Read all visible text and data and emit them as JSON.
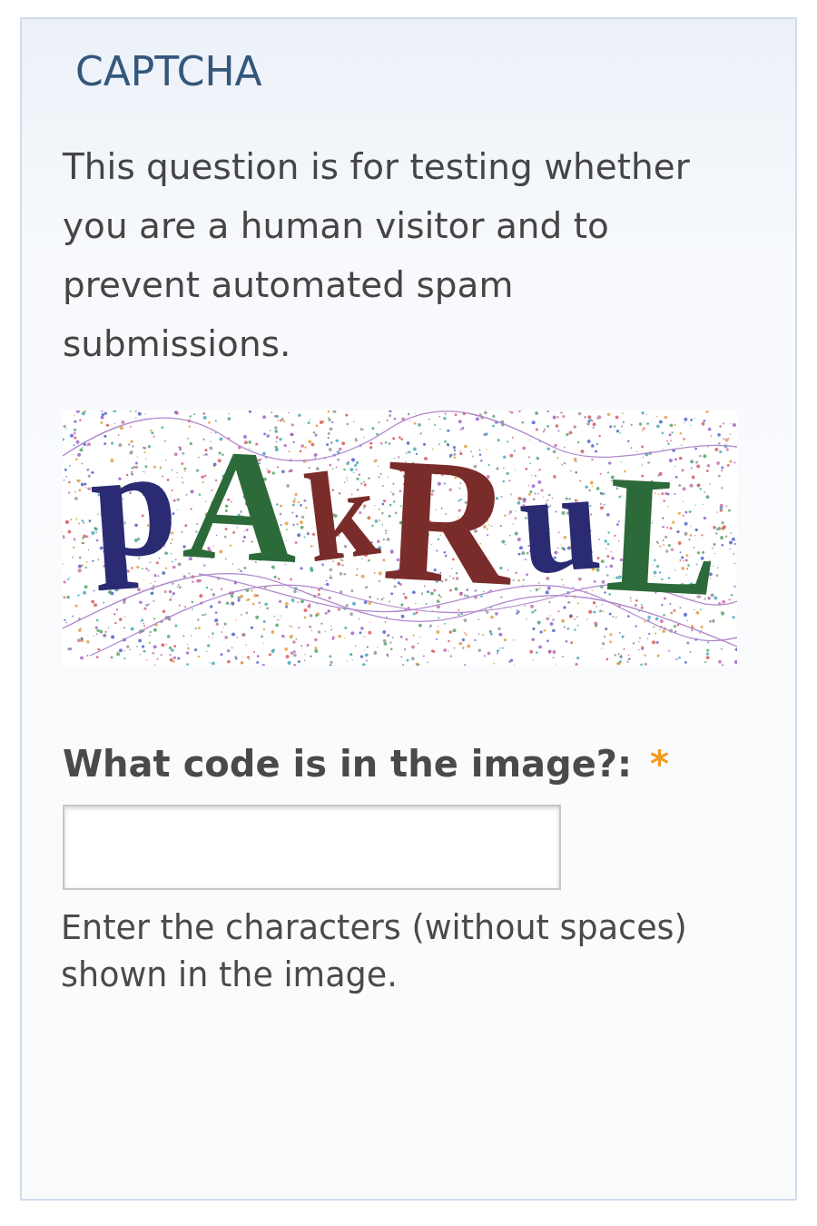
{
  "section": {
    "title": "CAPTCHA",
    "description": "This question is for testing whether you are a human visitor and to prevent automated spam submissions."
  },
  "captcha": {
    "letters": [
      {
        "char": "p",
        "color": "#2a2b72"
      },
      {
        "char": "A",
        "color": "#2d6a3a"
      },
      {
        "char": "k",
        "color": "#7a2c2a"
      },
      {
        "char": "R",
        "color": "#7a2c2a"
      },
      {
        "char": "u",
        "color": "#2a2b72"
      },
      {
        "char": "L",
        "color": "#2d6a3a"
      }
    ]
  },
  "field": {
    "label": "What code is in the image?:",
    "required_mark": "*",
    "help": "Enter the characters (without spaces) shown in the image."
  }
}
